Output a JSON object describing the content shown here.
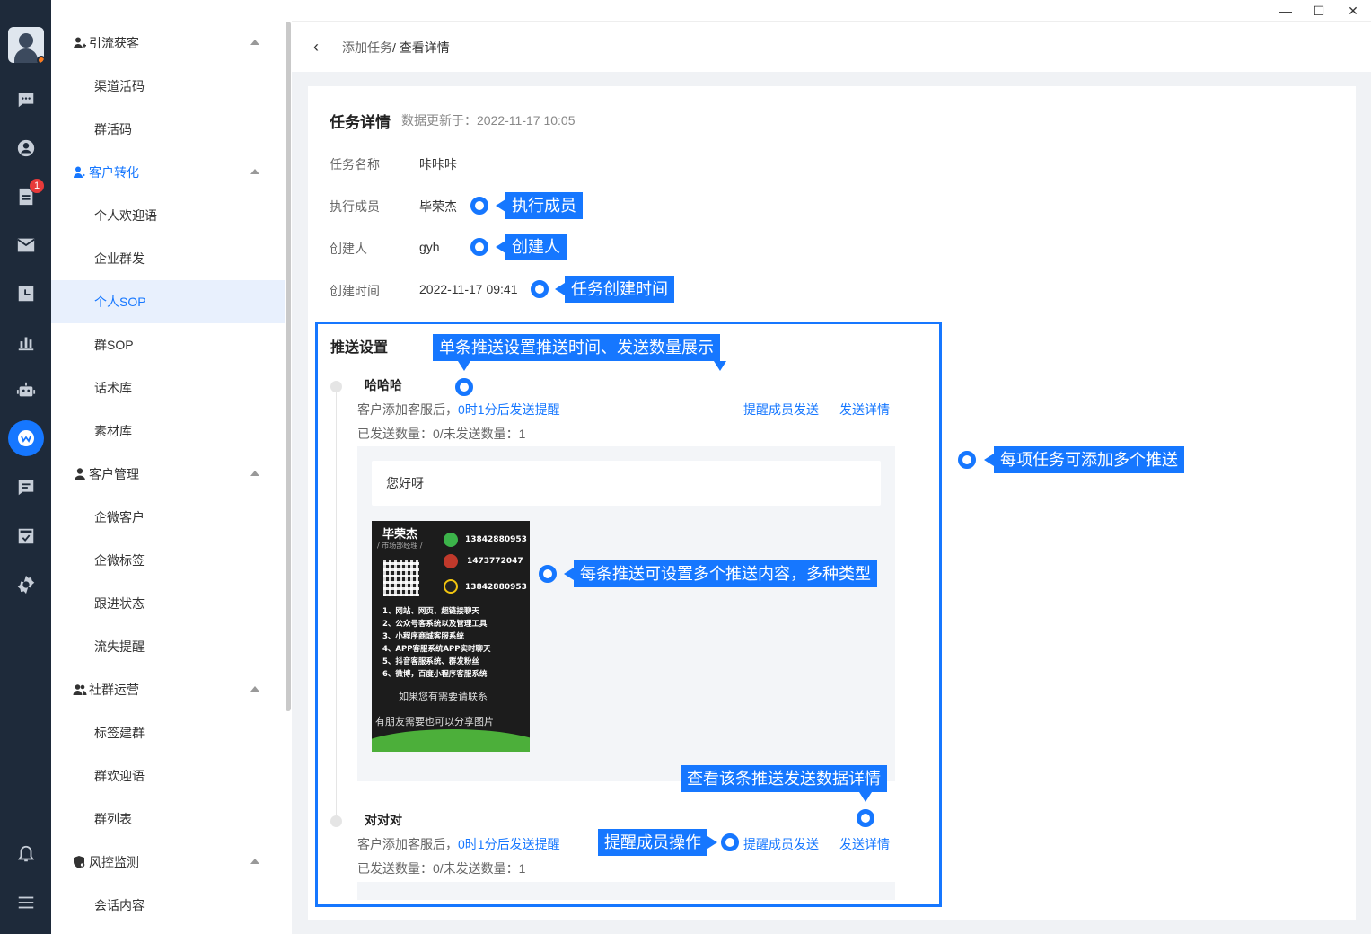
{
  "rail": {
    "badge": "1",
    "icons": [
      "chat-icon",
      "contact-icon",
      "document-icon",
      "mail-icon",
      "calendar-icon",
      "stats-icon",
      "robot-icon",
      "wecom-icon",
      "message-icon",
      "task-icon",
      "settings-icon",
      "bell-icon",
      "menu-icon"
    ]
  },
  "sidebar": {
    "groups": [
      {
        "label": "引流获客",
        "items": [
          "渠道活码",
          "群活码"
        ]
      },
      {
        "label": "客户转化",
        "items": [
          "个人欢迎语",
          "企业群发",
          "个人SOP",
          "群SOP",
          "话术库",
          "素材库"
        ]
      },
      {
        "label": "客户管理",
        "items": [
          "企微客户",
          "企微标签",
          "跟进状态",
          "流失提醒"
        ]
      },
      {
        "label": "社群运营",
        "items": [
          "标签建群",
          "群欢迎语",
          "群列表"
        ]
      },
      {
        "label": "风控监测",
        "items": [
          "会话内容"
        ]
      }
    ],
    "selected": "个人SOP"
  },
  "window": {
    "minimize": "—",
    "maximize": "☐",
    "close": "✕"
  },
  "breadcrumb": {
    "back": "‹",
    "parent": "添加任务",
    "sep": "/",
    "current": " 查看详情"
  },
  "detail": {
    "title": "任务详情",
    "updated": "数据更新于：2022-11-17 10:05",
    "fields": {
      "name_label": "任务名称",
      "name_value": "咔咔咔",
      "member_label": "执行成员",
      "member_value": "毕荣杰",
      "creator_label": "创建人",
      "creator_value": "gyh",
      "time_label": "创建时间",
      "time_value": "2022-11-17 09:41"
    }
  },
  "push": {
    "title": "推送设置",
    "items": [
      {
        "name": "哈哈哈",
        "desc_prefix": "客户添加客服后，",
        "desc_hl": "0时1分后发送提醒",
        "stats": "已发送数量：0/未发送数量：1",
        "remind": "提醒成员发送",
        "detail": "发送详情",
        "message": "您好呀"
      },
      {
        "name": "对对对",
        "desc_prefix": "客户添加客服后，",
        "desc_hl": "0时1分后发送提醒",
        "stats": "已发送数量：0/未发送数量：1",
        "remind": "提醒成员发送",
        "detail": "发送详情"
      }
    ]
  },
  "card_image": {
    "name": "毕荣杰",
    "role": "/ 市场部经理 /",
    "phone1": "13842880953",
    "phone2": "1473772047",
    "phone3": "13842880953",
    "lines": [
      "1、网站、网页、超链接聊天",
      "2、公众号客系统以及管理工具",
      "3、小程序商城客服系统",
      "4、APP客服系统APP实时聊天",
      "5、抖音客服系统、群发粉丝",
      "6、微博，百度小程序客服系统"
    ],
    "big1": "如果您有需要请联系",
    "big2": "有朋友需要也可以分享图片"
  },
  "annotations": {
    "member": "执行成员",
    "creator": "创建人",
    "create_time": "任务创建时间",
    "single_push": "单条推送设置推送时间、发送数量展示",
    "multi_push": "每项任务可添加多个推送",
    "multi_content": "每条推送可设置多个推送内容，多种类型",
    "send_detail": "查看该条推送发送数据详情",
    "remind_op": "提醒成员操作"
  },
  "colors": {
    "accent": "#1677ff",
    "rail_bg": "#1e2a3a",
    "badge": "#e83a3a"
  }
}
